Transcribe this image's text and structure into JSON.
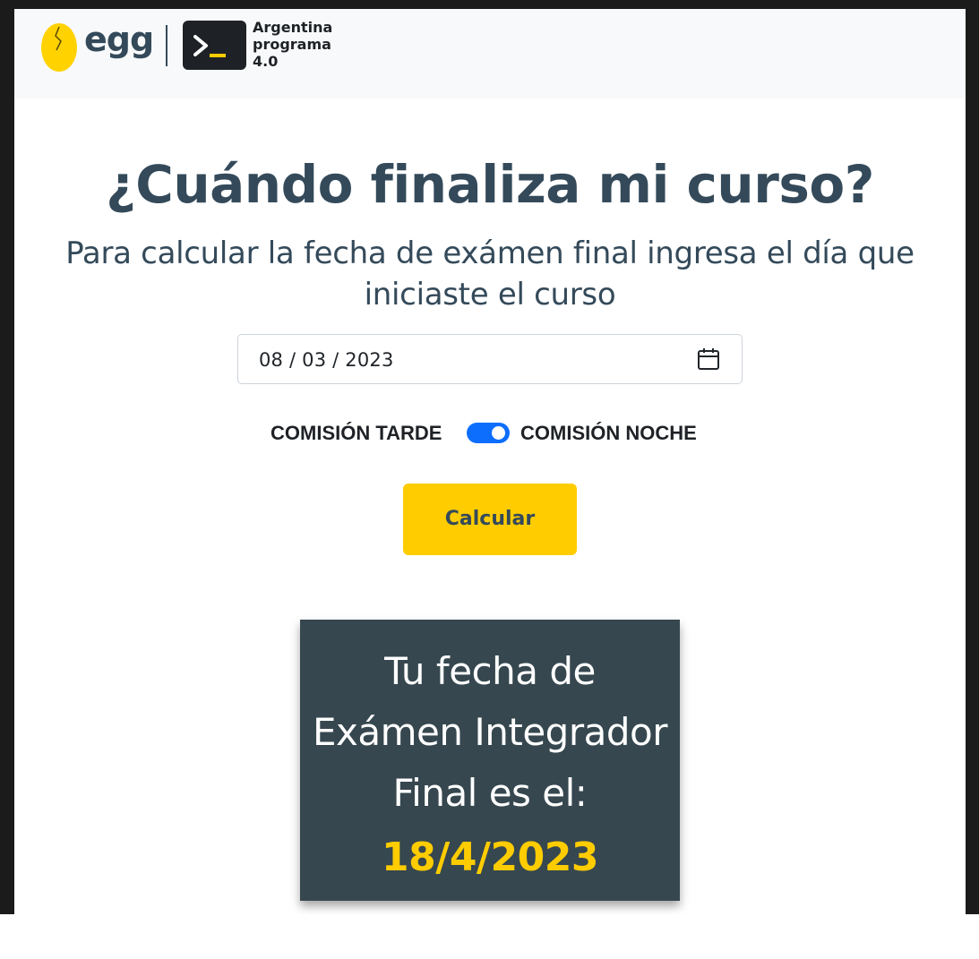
{
  "navbar": {
    "egg_logo_text": "egg",
    "partner_logo_lines": [
      "Argentina",
      "programa",
      "4.0"
    ]
  },
  "main": {
    "title": "¿Cuándo finaliza mi curso?",
    "subtitle": "Para calcular la fecha de exámen final ingresa el día que iniciaste el curso",
    "date_input": {
      "value": "08 / 03 / 2023",
      "icon": "calendar-icon"
    },
    "toggle": {
      "left_label": "COMISIÓN TARDE",
      "right_label": "COMISIÓN NOCHE",
      "checked": true,
      "color": "#0d6efd"
    },
    "calculate_button": "Calcular",
    "result": {
      "lines": [
        "Tu fecha de",
        "Exámen Integrador",
        "Final es el:"
      ],
      "date": "18/4/2023"
    }
  },
  "colors": {
    "brand_dark": "#344a5a",
    "brand_yellow": "#ffcc00",
    "card_bg": "#36474f",
    "navbar_bg": "#f8f9fa"
  }
}
